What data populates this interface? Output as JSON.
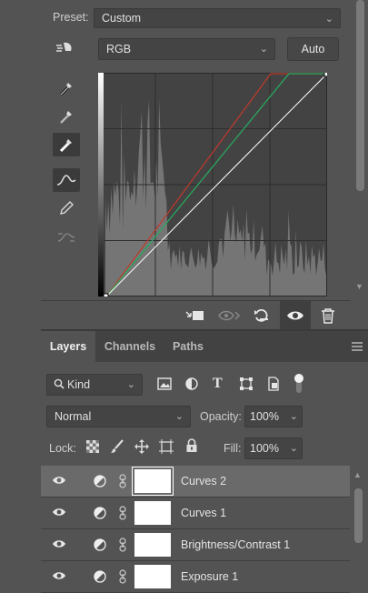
{
  "properties": {
    "preset_label": "Preset:",
    "preset_value": "Custom",
    "channel_value": "RGB",
    "auto_label": "Auto"
  },
  "layers_panel": {
    "tabs": [
      {
        "label": "Layers",
        "active": true
      },
      {
        "label": "Channels",
        "active": false
      },
      {
        "label": "Paths",
        "active": false
      }
    ],
    "filter_kind": "Kind",
    "blend_mode": "Normal",
    "opacity_label": "Opacity:",
    "opacity_value": "100%",
    "lock_label": "Lock:",
    "fill_label": "Fill:",
    "fill_value": "100%",
    "layers": [
      {
        "name": "Curves 2",
        "selected": true
      },
      {
        "name": "Curves 1",
        "selected": false
      },
      {
        "name": "Brightness/Contrast 1",
        "selected": false
      },
      {
        "name": "Exposure 1",
        "selected": false
      }
    ]
  },
  "colors": {
    "panel_bg": "#535353",
    "red_curve": "#c0392b",
    "green_curve": "#27ae60",
    "rgb_curve": "#ffffff"
  }
}
